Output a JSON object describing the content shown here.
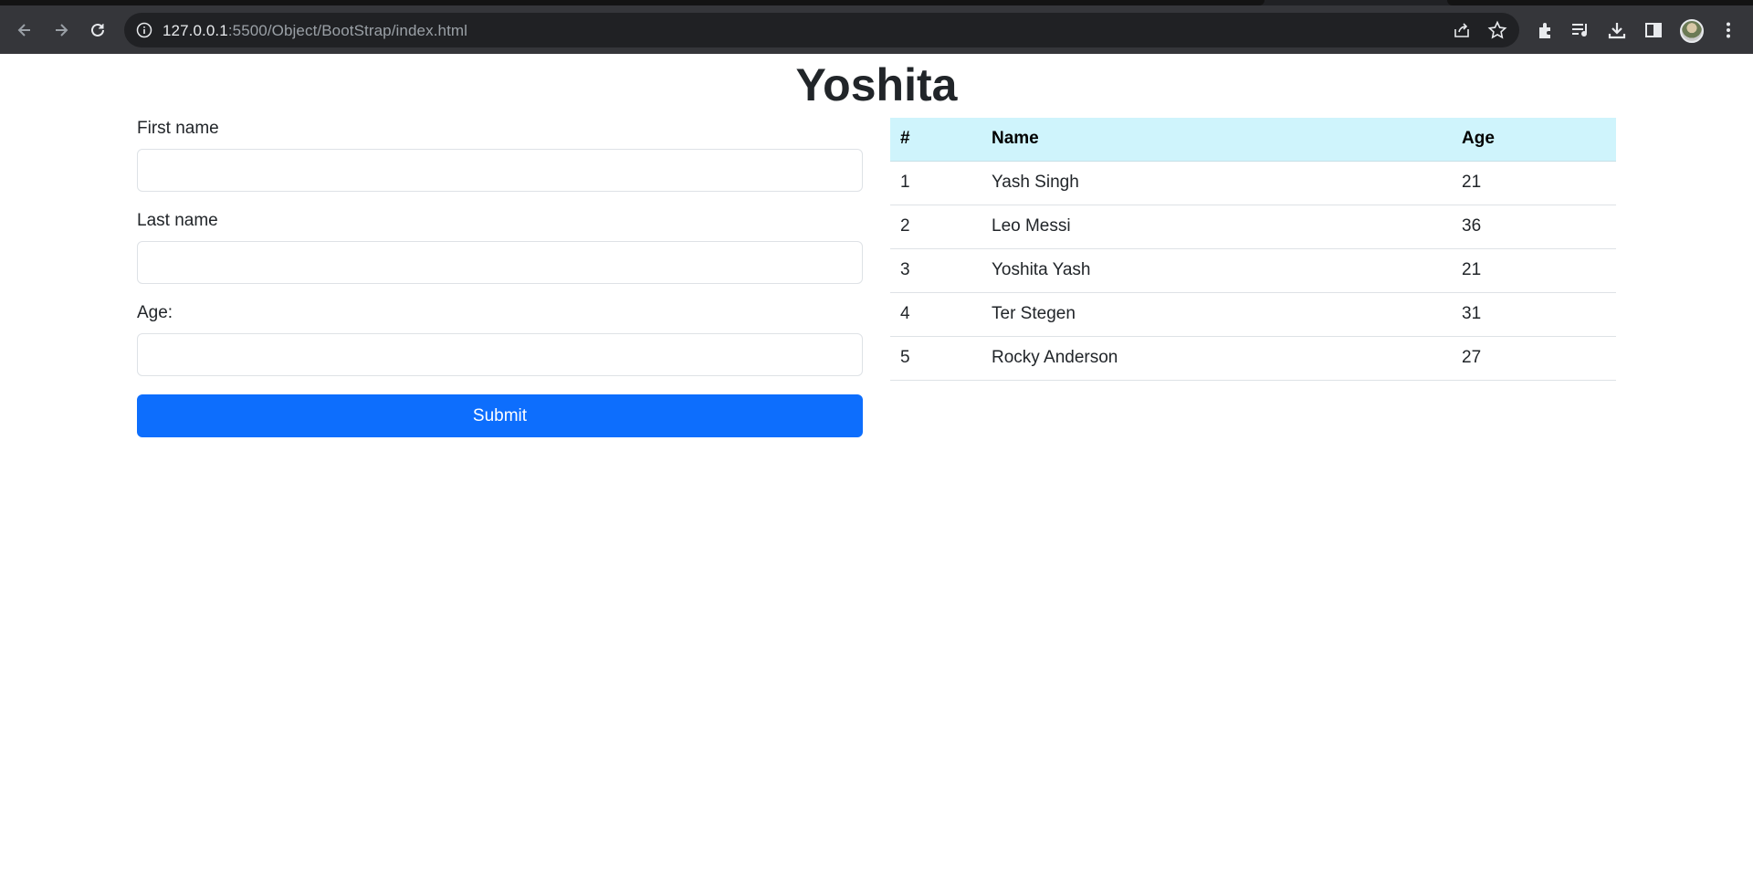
{
  "browser": {
    "url_host": "127.0.0.1",
    "url_rest": ":5500/Object/BootStrap/index.html"
  },
  "page": {
    "title": "Yoshita"
  },
  "form": {
    "first_name_label": "First name",
    "last_name_label": "Last name",
    "age_label": "Age:",
    "first_name_value": "",
    "last_name_value": "",
    "age_value": "",
    "submit_label": "Submit"
  },
  "table": {
    "headers": [
      "#",
      "Name",
      "Age"
    ],
    "rows": [
      {
        "num": "1",
        "name": "Yash Singh",
        "age": "21"
      },
      {
        "num": "2",
        "name": "Leo Messi",
        "age": "36"
      },
      {
        "num": "3",
        "name": "Yoshita Yash",
        "age": "21"
      },
      {
        "num": "4",
        "name": "Ter Stegen",
        "age": "31"
      },
      {
        "num": "5",
        "name": "Rocky Anderson",
        "age": "27"
      }
    ]
  },
  "colors": {
    "primary": "#0d6efd",
    "table_header_bg": "#cff4fc",
    "chrome_bg": "#35363a",
    "omnibox_bg": "#202124"
  },
  "icons": [
    "back-arrow-icon",
    "forward-arrow-icon",
    "reload-icon",
    "info-icon",
    "share-icon",
    "star-icon",
    "extensions-icon",
    "media-icon",
    "download-icon",
    "sidebar-icon",
    "profile-avatar",
    "menu-icon"
  ]
}
